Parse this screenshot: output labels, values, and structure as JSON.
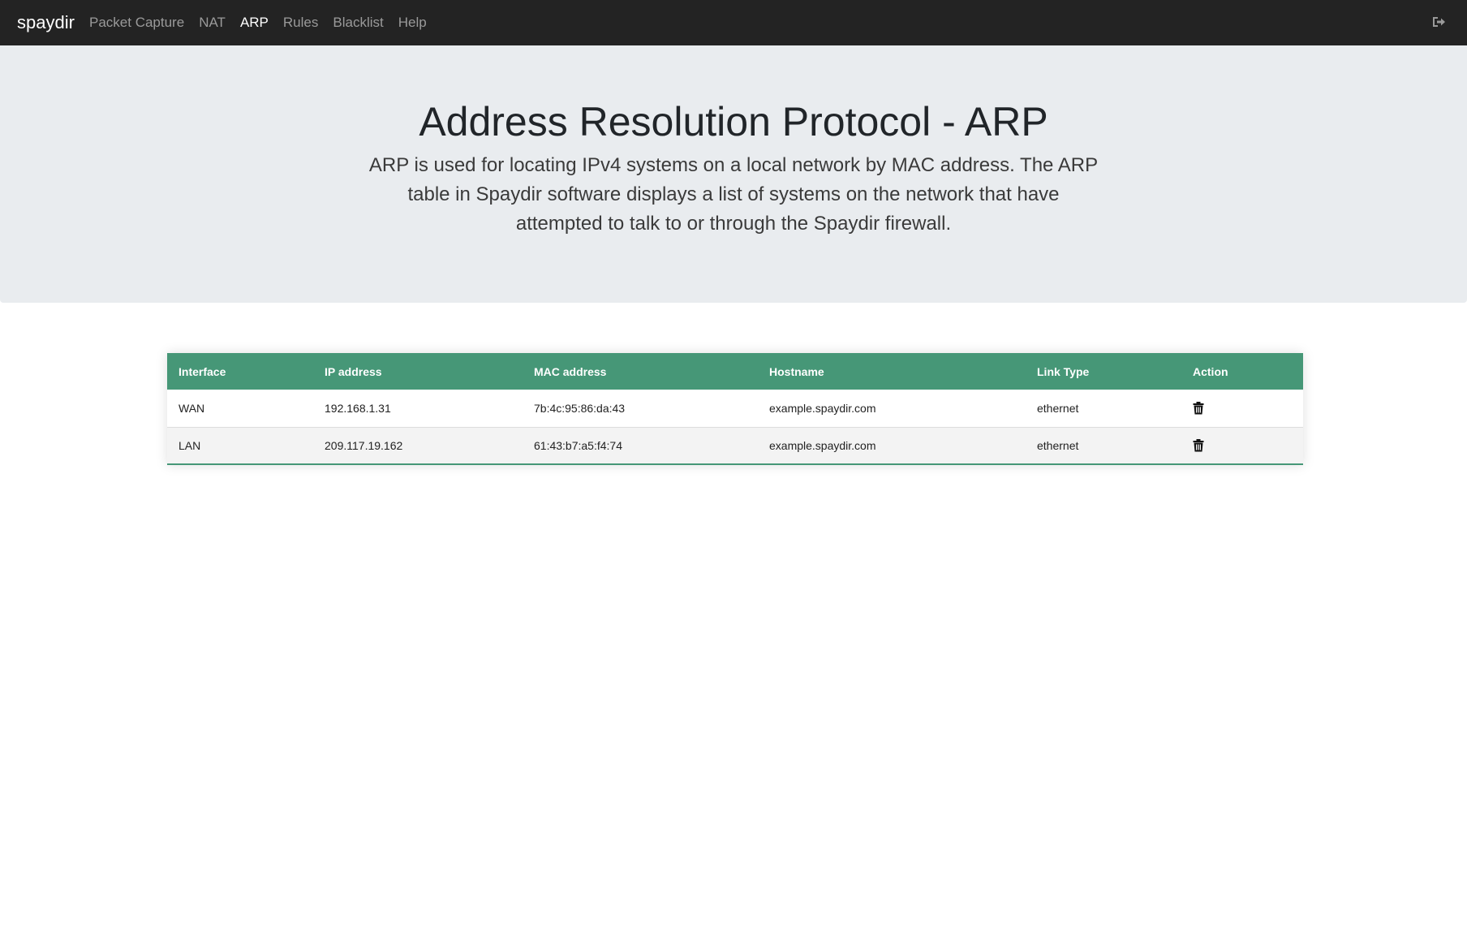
{
  "navbar": {
    "brand": "spaydir",
    "links": [
      {
        "label": "Packet Capture",
        "active": false
      },
      {
        "label": "NAT",
        "active": false
      },
      {
        "label": "ARP",
        "active": true
      },
      {
        "label": "Rules",
        "active": false
      },
      {
        "label": "Blacklist",
        "active": false
      },
      {
        "label": "Help",
        "active": false
      }
    ],
    "logout_icon": "sign-out-icon"
  },
  "jumbotron": {
    "title": "Address Resolution Protocol - ARP",
    "lead": "ARP is used for locating IPv4 systems on a local network by MAC address. The ARP table in Spaydir software displays a list of systems on the network that have attempted to talk to or through the Spaydir firewall."
  },
  "arp_table": {
    "columns": [
      "Interface",
      "IP address",
      "MAC address",
      "Hostname",
      "Link Type",
      "Action"
    ],
    "rows": [
      {
        "interface": "WAN",
        "ip": "192.168.1.31",
        "mac": "7b:4c:95:86:da:43",
        "hostname": "example.spaydir.com",
        "link_type": "ethernet",
        "action_icon": "trash-icon"
      },
      {
        "interface": "LAN",
        "ip": "209.117.19.162",
        "mac": "61:43:b7:a5:f4:74",
        "hostname": "example.spaydir.com",
        "link_type": "ethernet",
        "action_icon": "trash-icon"
      }
    ]
  },
  "colors": {
    "navbar_bg": "#232323",
    "jumbotron_bg": "#e9ecef",
    "table_header_bg": "#469777"
  }
}
